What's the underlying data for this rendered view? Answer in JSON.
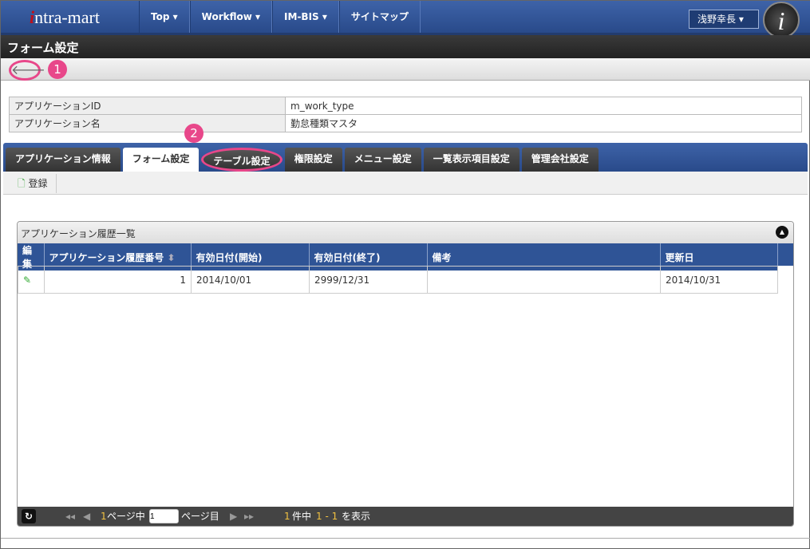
{
  "header": {
    "logo": "intra-mart",
    "nav": [
      "Top ▾",
      "Workflow ▾",
      "IM-BIS ▾",
      "サイトマップ"
    ],
    "user": "浅野幸長 ▾"
  },
  "page_title": "フォーム設定",
  "badges": [
    "1",
    "2"
  ],
  "info": [
    {
      "label": "アプリケーションID",
      "value": "m_work_type"
    },
    {
      "label": "アプリケーション名",
      "value": "勤怠種類マスタ"
    }
  ],
  "tabs": [
    "アプリケーション情報",
    "フォーム設定",
    "テーブル設定",
    "権限設定",
    "メニュー設定",
    "一覧表示項目設定",
    "管理会社設定"
  ],
  "register_label": "登録",
  "grid": {
    "caption": "アプリケーション履歴一覧",
    "columns": [
      "編集",
      "アプリケーション履歴番号",
      "有効日付(開始)",
      "有効日付(終了)",
      "備考",
      "更新日"
    ],
    "rows": [
      {
        "no": "1",
        "start": "2014/10/01",
        "end": "2999/12/31",
        "note": "",
        "updated": "2014/10/31"
      }
    ]
  },
  "pager": {
    "total_pages": "1",
    "of_label": "ページ中",
    "page": "1",
    "page_label": "ページ目",
    "count": "1",
    "count_label": "件中",
    "range": "1 - 1",
    "show_label": "を表示"
  },
  "colors": {
    "accent": "#e8478a",
    "nav": "#2f5496"
  }
}
